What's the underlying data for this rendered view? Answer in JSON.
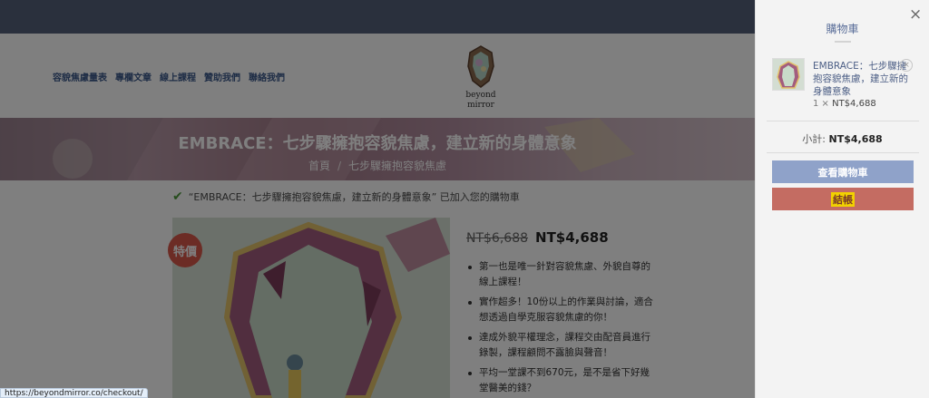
{
  "nav": [
    "容貌焦慮量表",
    "專欄文章",
    "線上課程",
    "贊助我們",
    "聯絡我們"
  ],
  "logo": {
    "line1": "beyond",
    "line2": "mirror"
  },
  "hero": {
    "title": "EMBRACE：七步驟擁抱容貌焦慮，建立新的身體意象",
    "crumb_home": "首頁",
    "crumb_sep": "/",
    "crumb_current": "七步驟擁抱容貌焦慮"
  },
  "notice": "“EMBRACE：七步驟擁抱容貌焦慮，建立新的身體意象” 已加入您的購物車",
  "product": {
    "badge": "特價",
    "old_price": "NT$6,688",
    "new_price": "NT$4,688",
    "bullets": [
      "第一也是唯一針對容貌焦慮、外貌自尊的線上課程！",
      "實作超多！10份以上的作業與討論，適合想透過自學克服容貌焦慮的你！",
      "達成外貌平權理念，課程交由配音員進行錄製，課程顧問不露臉與聲音！",
      "平均一堂課不到670元，是不是省下好幾堂醫美的錢？"
    ]
  },
  "status_url": "https://beyondmirror.co/checkout/",
  "cart": {
    "title": "購物車",
    "close": "×",
    "item_name": "EMBRACE：七步驟擁抱容貌焦慮，建立新的身體意象",
    "item_qty": "1 ×",
    "item_price": "NT$4,688",
    "remove": "×",
    "subtotal_label": "小計:",
    "subtotal_value": "NT$4,688",
    "view_cart": "查看購物車",
    "checkout": "結帳"
  },
  "colors": {
    "nav_text": "#3d5a8c",
    "top_bar": "#55617a",
    "view_button": "#8fa2c9",
    "checkout_button": "#c46c62",
    "sale_badge": "#d8584a"
  }
}
